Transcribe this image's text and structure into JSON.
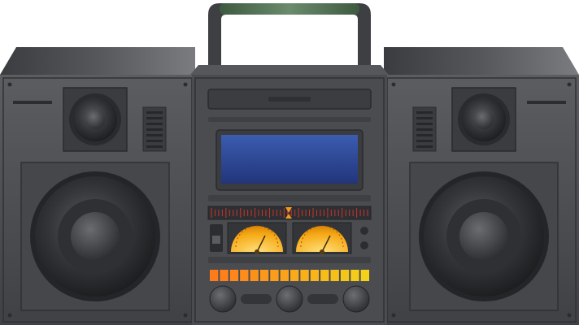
{
  "scene": {
    "subject": "",
    "colors": {
      "background": "#ffffff",
      "body": "#4a4c50",
      "body_dark": "#2f3134",
      "body_light": "#6a6c70",
      "handle_grip": "#5a7a5c",
      "display": "#2f4f9a",
      "vu_face": "#f2a516",
      "eq_low": "#ff7a1a",
      "eq_high": "#f4d21a",
      "tuner_red": "#c8352a"
    },
    "equalizer": {
      "bar_count": 16
    },
    "tuner": {
      "tick_count": 44
    }
  }
}
